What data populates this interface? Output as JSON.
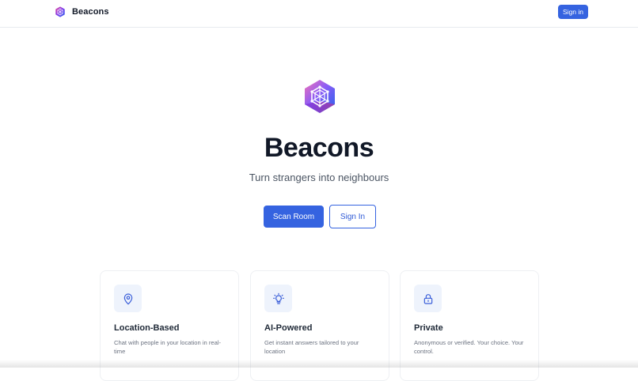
{
  "header": {
    "brand_name": "Beacons",
    "signin_label": "Sign in"
  },
  "hero": {
    "title": "Beacons",
    "subtitle": "Turn strangers into neighbours",
    "primary_label": "Scan Room",
    "secondary_label": "Sign In"
  },
  "features": [
    {
      "icon": "location-pin-icon",
      "title": "Location-Based",
      "description": "Chat with people in your location in real-time"
    },
    {
      "icon": "lightbulb-icon",
      "title": "AI-Powered",
      "description": "Get instant answers tailored to your location"
    },
    {
      "icon": "lock-icon",
      "title": "Private",
      "description": "Anonymous or verified. Your choice. Your control."
    }
  ],
  "colors": {
    "accent": "#3563e0",
    "logo_gradient": [
      "#7c3aed",
      "#2563eb",
      "#ec4899"
    ]
  }
}
